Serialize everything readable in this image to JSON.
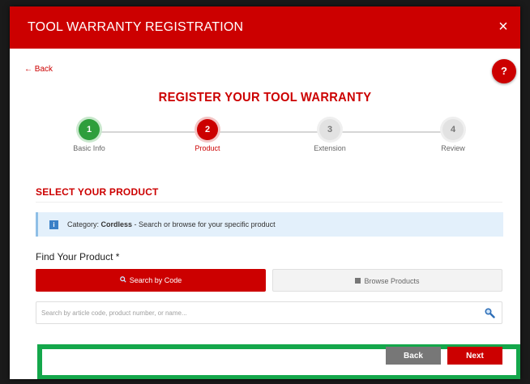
{
  "modal": {
    "title": "TOOL WARRANTY REGISTRATION",
    "close_icon": "close-icon",
    "close_glyph": "×"
  },
  "nav": {
    "back_label": "← Back",
    "help_label": "?"
  },
  "heading": "REGISTER YOUR TOOL WARRANTY",
  "steps": [
    {
      "number": "1",
      "label": "Basic Info",
      "state": "done"
    },
    {
      "number": "2",
      "label": "Product",
      "state": "active"
    },
    {
      "number": "3",
      "label": "Extension",
      "state": "pending"
    },
    {
      "number": "4",
      "label": "Review",
      "state": "pending"
    }
  ],
  "section": {
    "title": "SELECT YOUR PRODUCT"
  },
  "info": {
    "icon": "info-icon",
    "icon_glyph": "i",
    "prefix": "Category: ",
    "category": "Cordless",
    "suffix": " - Search or browse for your specific product"
  },
  "find": {
    "label": "Find Your Product *",
    "tabs": {
      "search_label": "Search by Code",
      "search_icon": "search-icon",
      "browse_label": "Browse Products",
      "browse_icon": "grid-icon"
    },
    "search_placeholder": "Search by article code, product number, or name..."
  },
  "footer": {
    "back_label": "Back",
    "next_label": "Next"
  },
  "colors": {
    "brand_red": "#cc0000",
    "step_done": "#2e9e3c",
    "highlight": "#14a74b",
    "info_bg": "#e3f0fb"
  }
}
